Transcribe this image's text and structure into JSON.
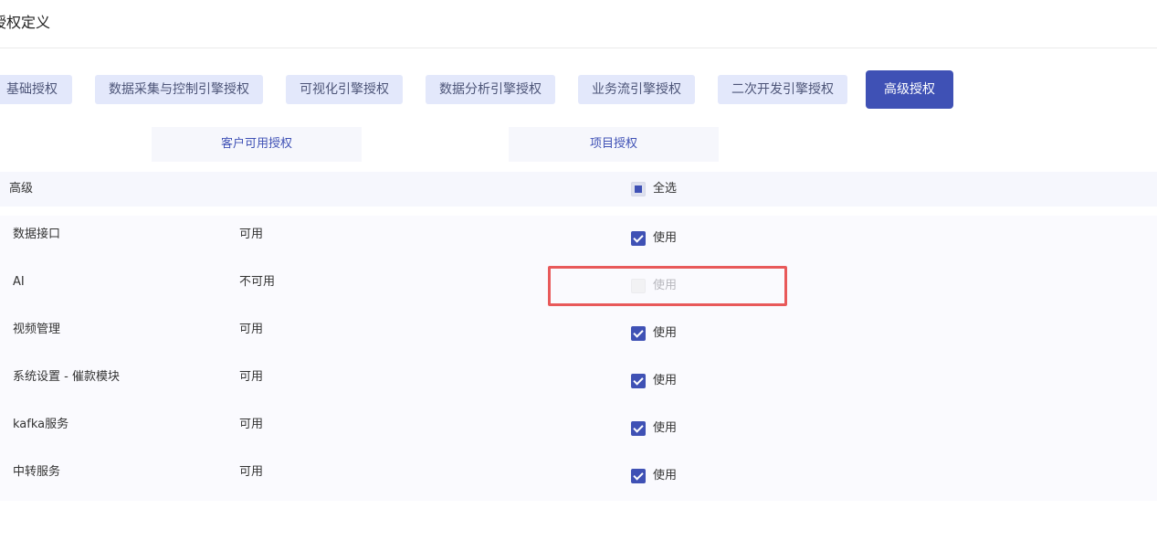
{
  "header": {
    "title": "授权定义"
  },
  "main_tabs": [
    {
      "label": "基础授权"
    },
    {
      "label": "数据采集与控制引擎授权"
    },
    {
      "label": "可视化引擎授权"
    },
    {
      "label": "数据分析引擎授权"
    },
    {
      "label": "业务流引擎授权"
    },
    {
      "label": "二次开发引擎授权"
    },
    {
      "label": "高级授权",
      "active": true
    }
  ],
  "sub_tabs": [
    {
      "label": "客户可用授权"
    },
    {
      "label": "项目授权"
    }
  ],
  "group": {
    "title": "高级",
    "select_all_label": "全选",
    "select_all_state": "indeterminate"
  },
  "rows": [
    {
      "name": "数据接口",
      "status": "可用",
      "use_label": "使用",
      "checked": true,
      "disabled": false
    },
    {
      "name": "AI",
      "status": "不可用",
      "use_label": "使用",
      "checked": false,
      "disabled": true
    },
    {
      "name": "视频管理",
      "status": "可用",
      "use_label": "使用",
      "checked": true,
      "disabled": false
    },
    {
      "name": "系统设置 - 催款模块",
      "status": "可用",
      "use_label": "使用",
      "checked": true,
      "disabled": false
    },
    {
      "name": "kafka服务",
      "status": "可用",
      "use_label": "使用",
      "checked": true,
      "disabled": false
    },
    {
      "name": "中转服务",
      "status": "可用",
      "use_label": "使用",
      "checked": true,
      "disabled": false
    }
  ],
  "colors": {
    "accent": "#3f51b5",
    "tab_bg": "#e3e8fb",
    "highlight": "#e8595a"
  }
}
